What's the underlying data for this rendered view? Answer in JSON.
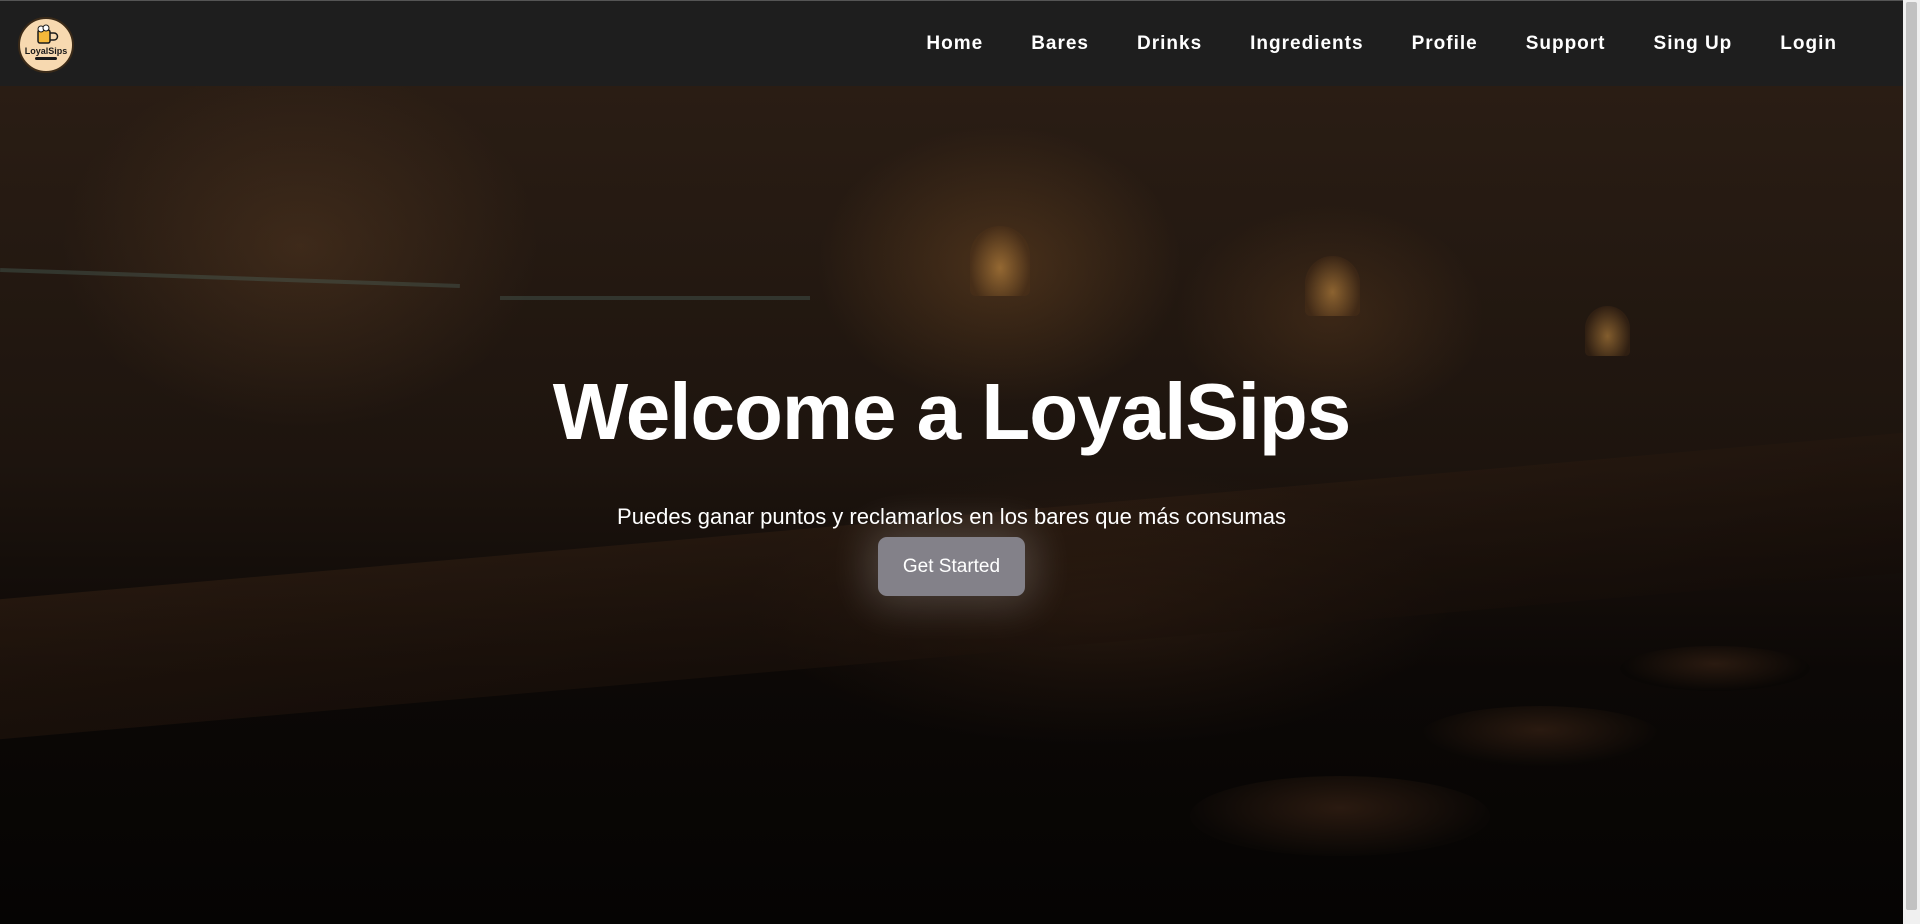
{
  "brand": {
    "logo_text": "LoyalSips",
    "logo_icon": "beer-mug-icon"
  },
  "nav": {
    "links": [
      "Home",
      "Bares",
      "Drinks",
      "Ingredients",
      "Profile",
      "Support",
      "Sing Up",
      "Login"
    ]
  },
  "hero": {
    "title": "Welcome a LoyalSips",
    "subtitle": "Puedes ganar puntos y reclamarlos en los bares que más consumas",
    "cta_label": "Get Started"
  },
  "colors": {
    "navbar_bg": "#1e1e1e",
    "cta_bg": "#838189",
    "text": "#ffffff"
  }
}
